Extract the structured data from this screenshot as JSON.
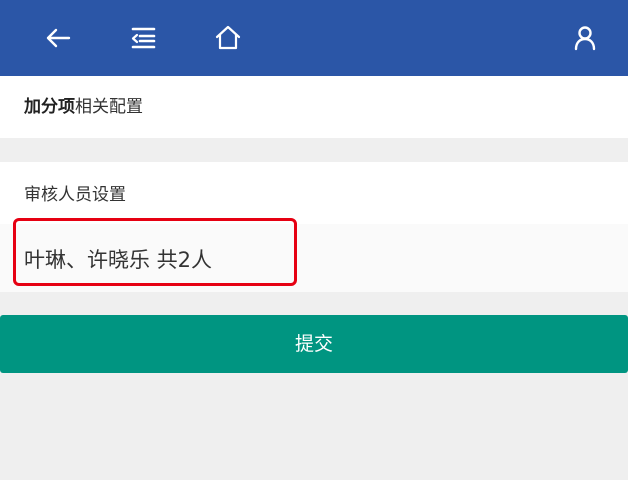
{
  "header": {
    "icons": [
      "back-arrow-icon",
      "menu-collapse-icon",
      "home-icon",
      "user-icon"
    ],
    "background_color": "#2b56a7"
  },
  "bonus_section": {
    "title_bold": "加分项",
    "title_rest": "相关配置"
  },
  "reviewer_section": {
    "label": "审核人员设置",
    "value": "叶琳、许晓乐 共2人"
  },
  "submit": {
    "label": "提交",
    "color": "#009581"
  },
  "annotation": {
    "highlight_color": "#e60012"
  }
}
